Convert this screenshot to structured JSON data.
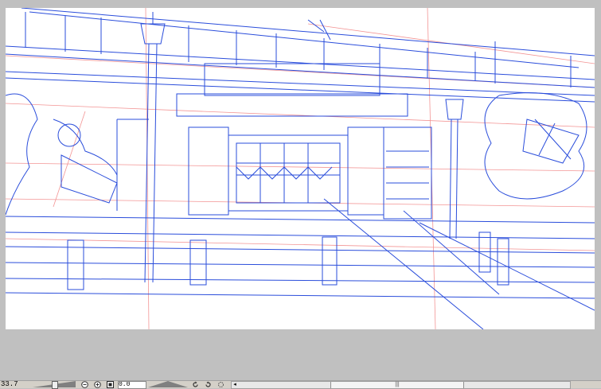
{
  "canvas": {
    "paper_color": "#ffffff",
    "background_color": "#c0c0c0",
    "blue_line_color": "#2a4ddb",
    "red_line_color": "#f07a7a"
  },
  "statusbar": {
    "zoom_value": "33.7",
    "zoom_out_icon": "zoom-out-icon",
    "zoom_in_icon": "zoom-in-icon",
    "fit_icon": "fit-to-window-icon",
    "angle_value": "0.0",
    "rotate_left_icon": "rotate-left-icon",
    "rotate_right_icon": "rotate-right-icon",
    "reset_rotation_icon": "reset-rotation-icon",
    "scroll_left_icon": "scroll-left-icon",
    "scroll_thumb_grip": "|||"
  }
}
